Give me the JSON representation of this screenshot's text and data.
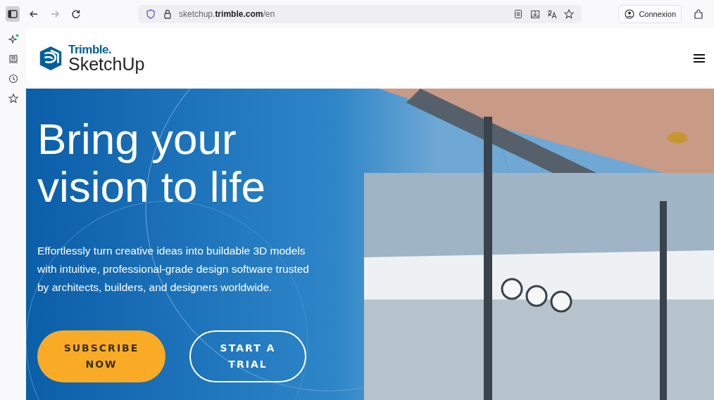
{
  "browser": {
    "sidebar_toggle": {
      "selected": true
    },
    "nav_buttons": [
      {
        "kind": "back",
        "disabled": false
      },
      {
        "kind": "forward",
        "disabled": true
      },
      {
        "kind": "reload",
        "disabled": false
      }
    ],
    "address": "sketchup.**trimble.com**/en",
    "account_button": "Connexion"
  },
  "side_panel": {
    "items": [
      {
        "kind": "assistant",
        "has_notification": true
      },
      {
        "kind": "save"
      },
      {
        "kind": "history"
      },
      {
        "kind": "bookmarks"
      }
    ]
  },
  "header": {
    "logo_top": "Trimble.",
    "logo_bottom": "SketchUp"
  },
  "hero": {
    "title": "Bring your vision to life",
    "description": "Effortlessly turn creative ideas into buildable 3D models with intuitive, professional-grade design software trusted by architects, builders, and designers worldwide.",
    "buttons": [
      {
        "kind": "primary",
        "label": "SUBSCRIBE NOW"
      },
      {
        "kind": "outline",
        "label": "START A TRIAL"
      }
    ]
  }
}
